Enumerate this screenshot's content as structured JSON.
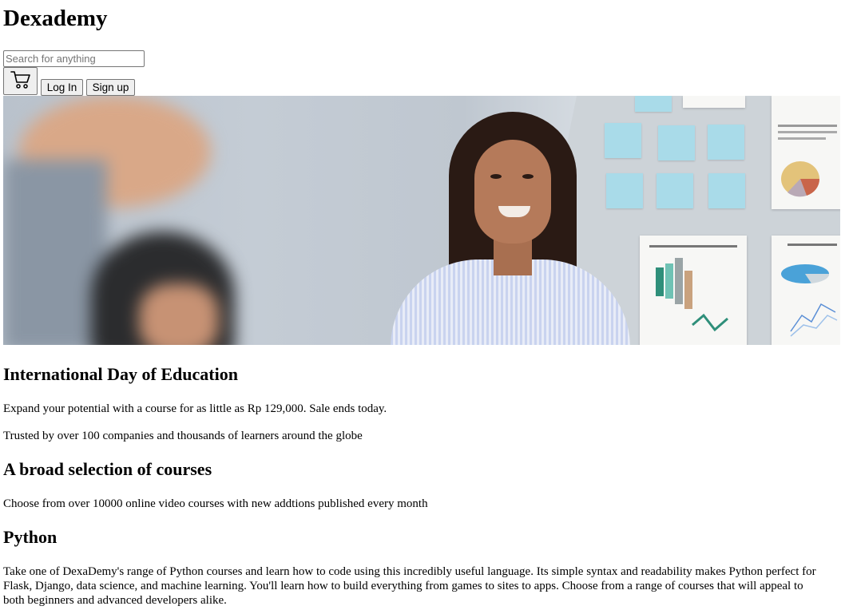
{
  "header": {
    "site_title": "Dexademy",
    "search_placeholder": "Search for anything",
    "cart_icon": "shopping-cart-icon",
    "login_label": "Log In",
    "signup_label": "Sign up"
  },
  "hero": {
    "image_alt": "Smiling woman in a striped shirt in an office with sticky notes and charts on the wall"
  },
  "promo": {
    "heading": "International Day of Education",
    "text": "Expand your potential with a course for as little as Rp 129,000. Sale ends today.",
    "trusted": "Trusted by over 100 companies and thousands of learners around the globe"
  },
  "courses": {
    "heading": "A broad selection of courses",
    "text": "Choose from over 10000 online video courses with new addtions published every month"
  },
  "python": {
    "heading": "Python",
    "text": "Take one of DexaDemy's range of Python courses and learn how to code using this incredibly useful language. Its simple syntax and readability makes Python perfect for Flask, Django, data science, and machine learning. You'll learn how to build everything from games to sites to apps. Choose from a range of courses that will appeal to both beginners and advanced developers alike."
  },
  "colors": {
    "button_bg": "#efefef",
    "button_border": "#767676",
    "sticky_note": "#a9dbe9"
  }
}
